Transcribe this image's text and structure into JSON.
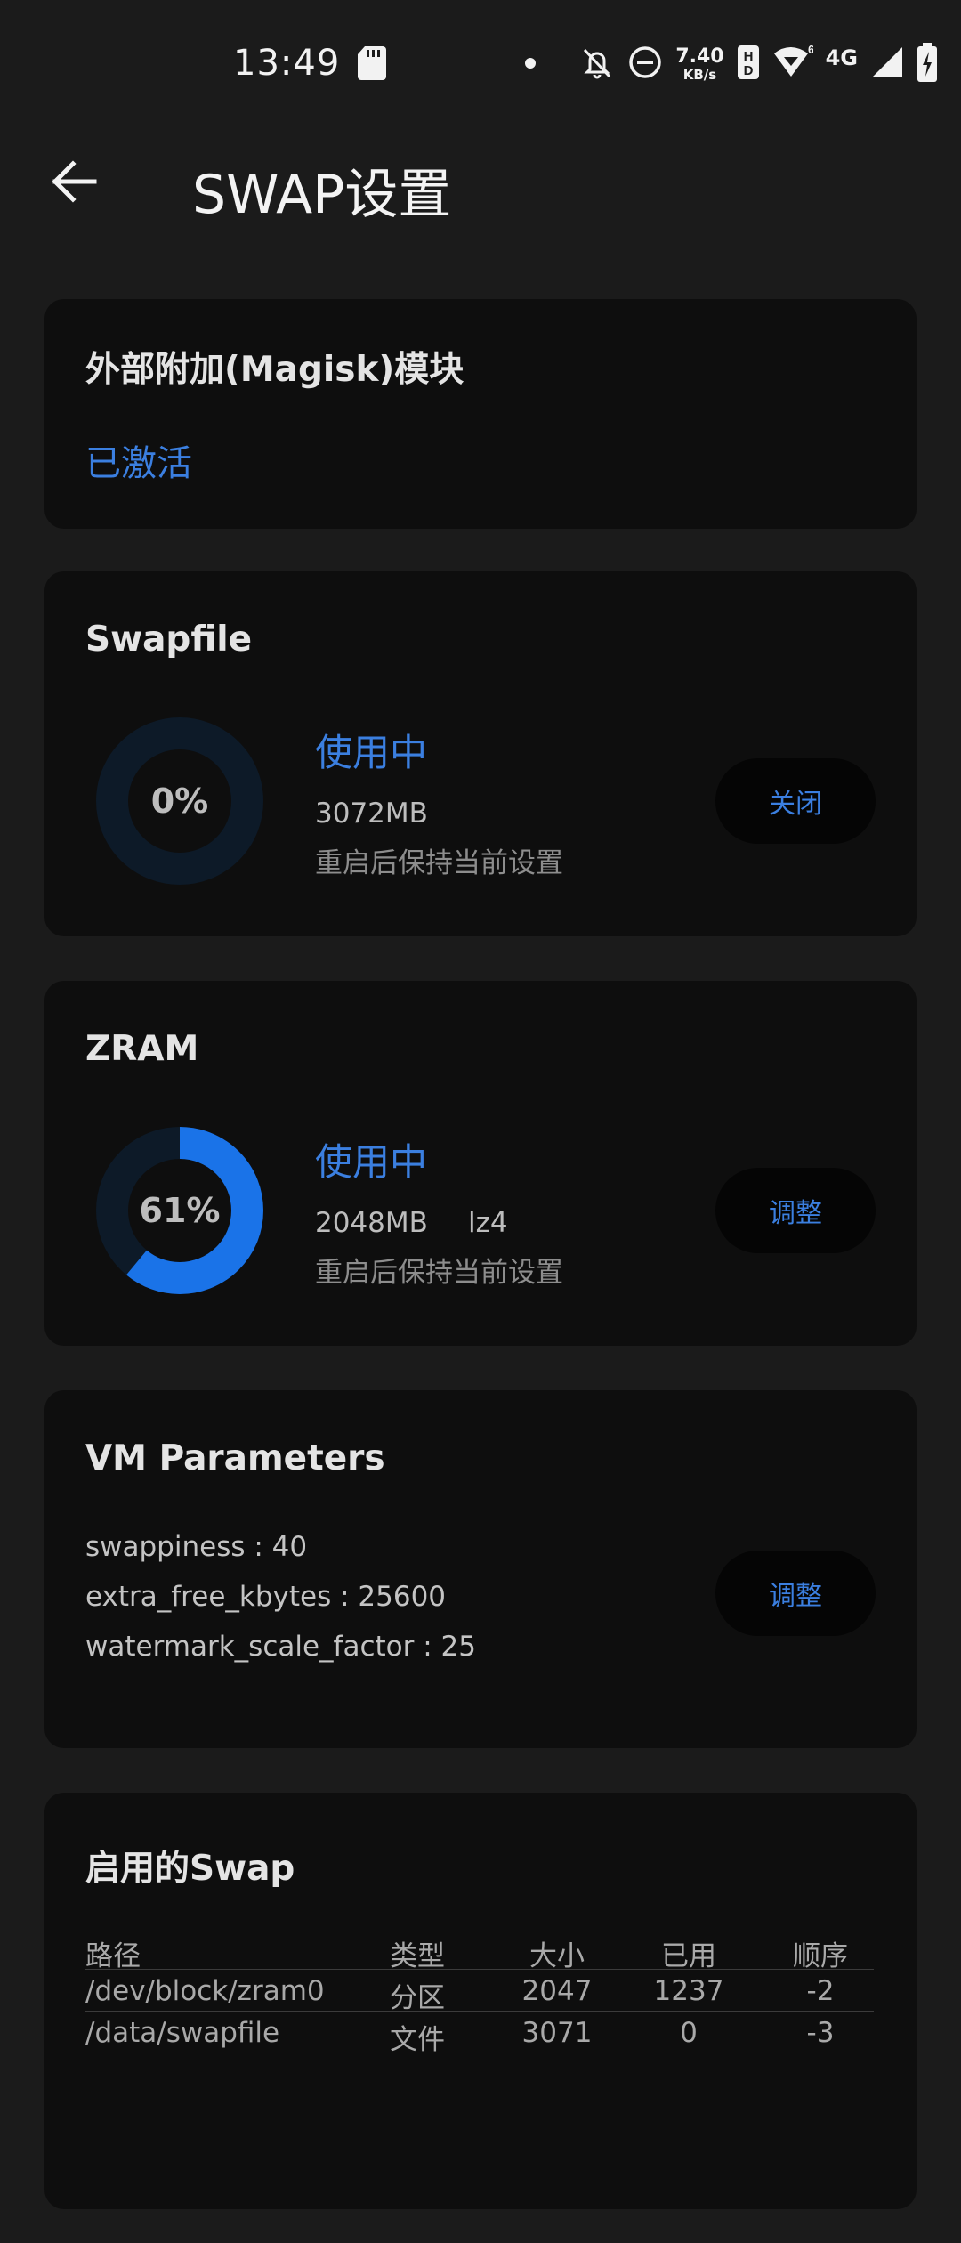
{
  "status_bar": {
    "time": "13:49",
    "net_speed_value": "7.40",
    "net_speed_unit": "KB/s",
    "network_type": "4G",
    "icons": [
      "sd-card-icon",
      "dot-icon",
      "bell-off-icon",
      "do-not-disturb-icon",
      "hd-icon",
      "wifi-icon",
      "signal-icon",
      "battery-charging-icon"
    ]
  },
  "app_bar": {
    "title": "SWAP设置",
    "back_icon": "arrow-left-icon"
  },
  "module_card": {
    "title": "外部附加(Magisk)模块",
    "status": "已激活"
  },
  "swapfile_card": {
    "title": "Swapfile",
    "usage_percent": 0,
    "usage_label": "0%",
    "status": "使用中",
    "size": "3072MB",
    "note": "重启后保持当前设置",
    "button": "关闭"
  },
  "zram_card": {
    "title": "ZRAM",
    "usage_percent": 61,
    "usage_label": "61%",
    "status": "使用中",
    "size": "2048MB",
    "algorithm": "lz4",
    "note": "重启后保持当前设置",
    "button": "调整"
  },
  "vm_card": {
    "title": "VM Parameters",
    "params": [
      "swappiness : 40",
      "extra_free_kbytes : 25600",
      "watermark_scale_factor : 25"
    ],
    "button": "调整"
  },
  "swap_table_card": {
    "title": "启用的Swap",
    "headers": [
      "路径",
      "类型",
      "大小",
      "已用",
      "顺序"
    ],
    "rows": [
      [
        "/dev/block/zram0",
        "分区",
        "2047",
        "1237",
        "-2"
      ],
      [
        "/data/swapfile",
        "文件",
        "3071",
        "0",
        "-3"
      ]
    ]
  },
  "colors": {
    "accent": "#3b7fe0",
    "ring_fill": "#1a73e8",
    "ring_track": "#0d1a28",
    "background": "#1b1b1b",
    "card": "#0e0e0e"
  }
}
